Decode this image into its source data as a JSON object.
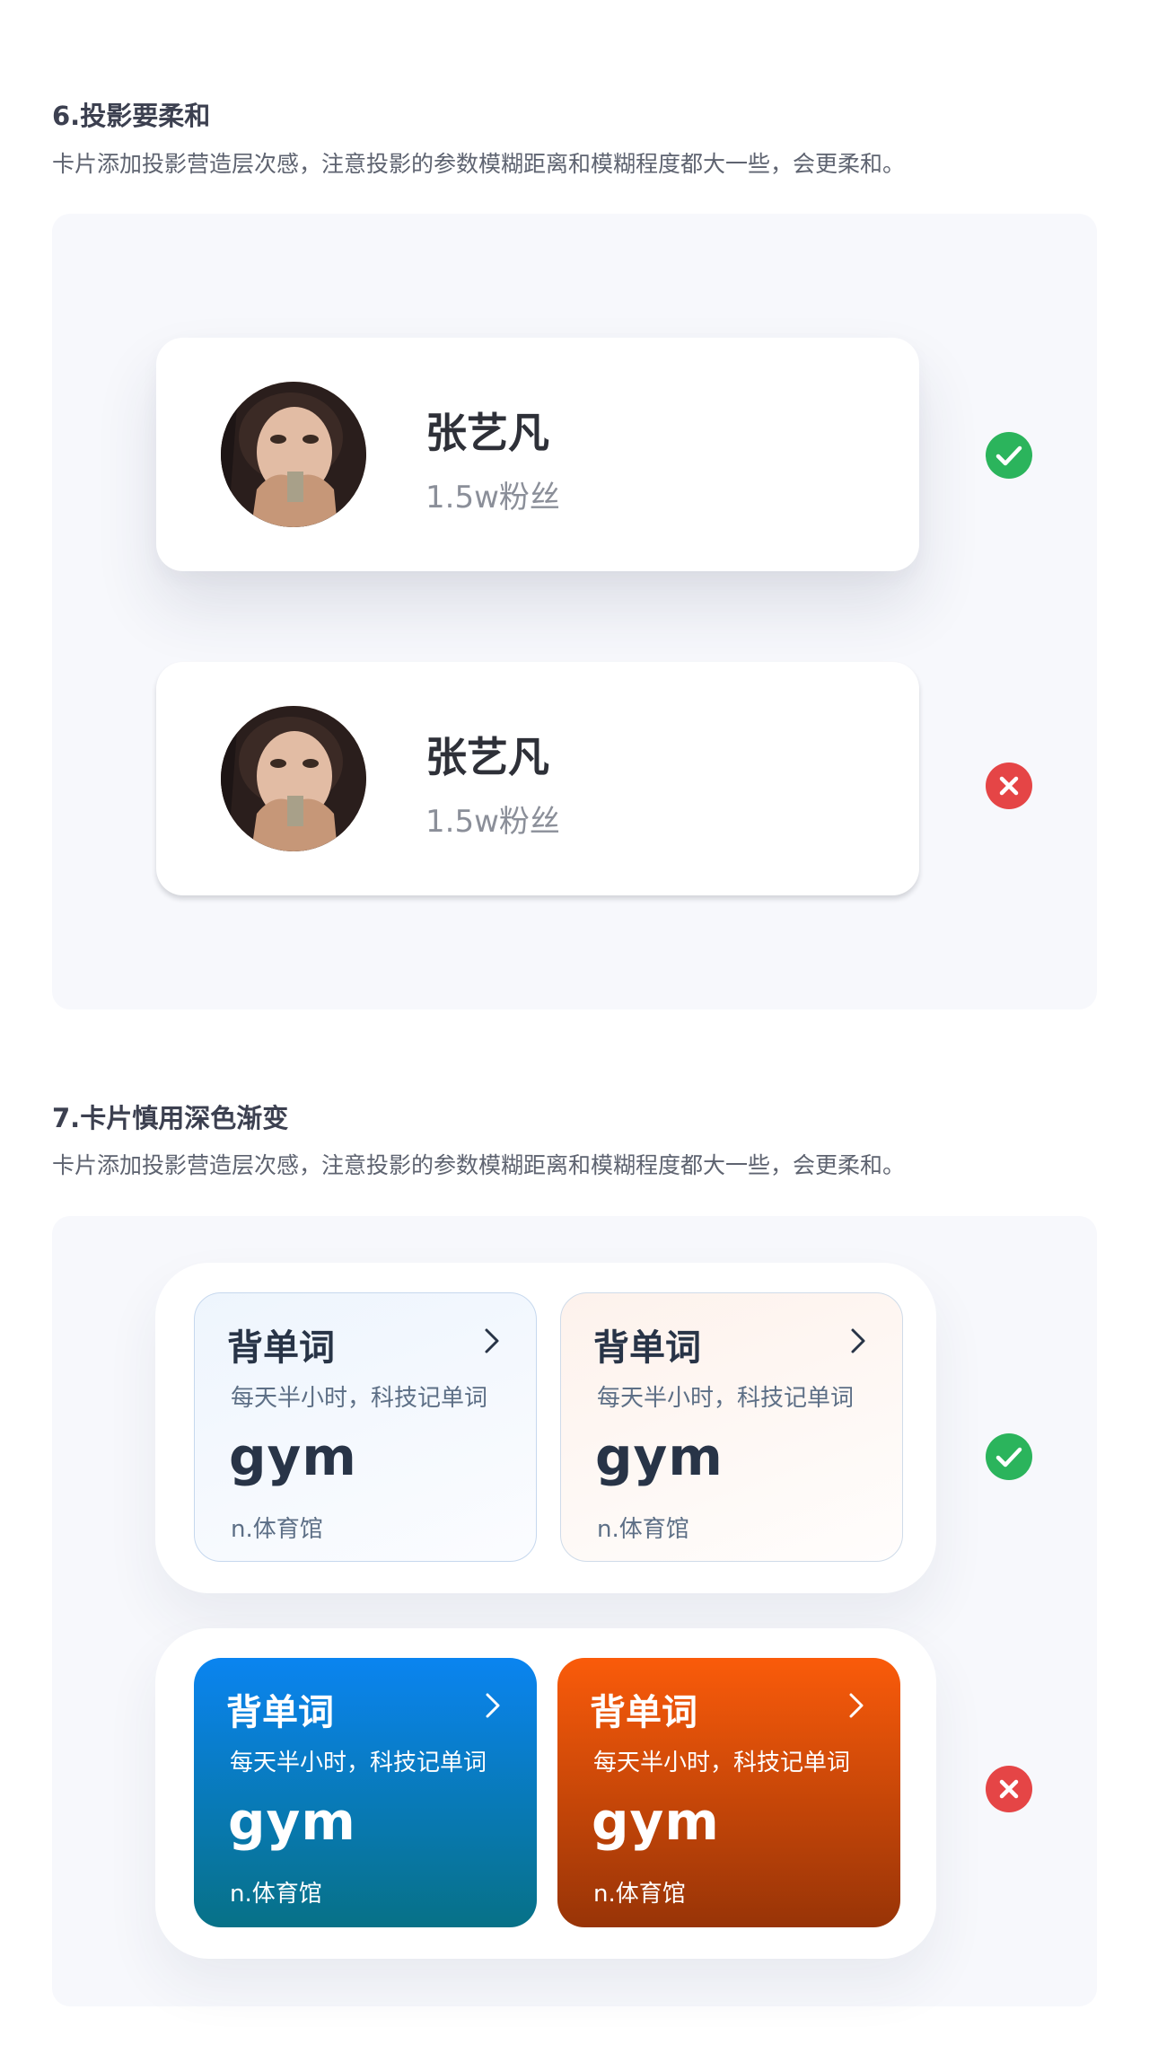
{
  "section6": {
    "title": "6.投影要柔和",
    "description": "卡片添加投影营造层次感，注意投影的参数模糊距离和模糊程度都大一些，会更柔和。",
    "cards": [
      {
        "name": "张艺凡",
        "fans": "1.5w粉丝",
        "verdict": "correct"
      },
      {
        "name": "张艺凡",
        "fans": "1.5w粉丝",
        "verdict": "incorrect"
      }
    ]
  },
  "section7": {
    "title": "7.卡片慎用深色渐变",
    "description": "卡片添加投影营造层次感，注意投影的参数模糊距离和模糊程度都大一些，会更柔和。",
    "groups": [
      {
        "verdict": "correct",
        "cards": [
          {
            "title": "背单词",
            "subtitle": "每天半小时，科技记单词",
            "word": "gym",
            "meaning": "n.体育馆",
            "style": "light-blue"
          },
          {
            "title": "背单词",
            "subtitle": "每天半小时，科技记单词",
            "word": "gym",
            "meaning": "n.体育馆",
            "style": "light-peach"
          }
        ]
      },
      {
        "verdict": "incorrect",
        "cards": [
          {
            "title": "背单词",
            "subtitle": "每天半小时，科技记单词",
            "word": "gym",
            "meaning": "n.体育馆",
            "style": "dark-blue"
          },
          {
            "title": "背单词",
            "subtitle": "每天半小时，科技记单词",
            "word": "gym",
            "meaning": "n.体育馆",
            "style": "dark-orange"
          }
        ]
      }
    ]
  },
  "colors": {
    "correct": "#2bb45c",
    "incorrect": "#e54546",
    "panel_bg": "#f7f8fc",
    "dark_blue_top": "#0a84f0",
    "dark_blue_bottom": "#077187",
    "dark_orange_top": "#fa5b0a",
    "dark_orange_bottom": "#983407"
  },
  "icons": {
    "correct": "check-circle-icon",
    "incorrect": "x-circle-icon",
    "arrow": "chevron-right-icon"
  }
}
